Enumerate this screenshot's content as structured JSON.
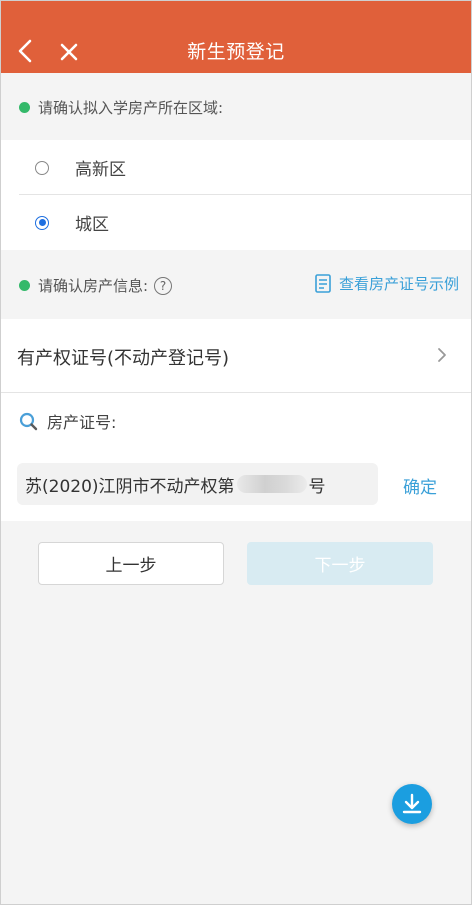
{
  "header": {
    "title": "新生预登记"
  },
  "area_section": {
    "prompt": "请确认拟入学房产所在区域:",
    "options": [
      {
        "label": "高新区",
        "selected": false
      },
      {
        "label": "城区",
        "selected": true
      }
    ]
  },
  "property_section": {
    "prompt": "请确认房产信息:",
    "help_glyph": "?",
    "example_link": "查看房产证号示例"
  },
  "certificate_type": {
    "label": "有产权证号(不动产登记号)"
  },
  "certificate_search": {
    "label": "房产证号:",
    "value_prefix": "苏(2020)江阴市不动产权第",
    "value_suffix": "号",
    "confirm_label": "确定"
  },
  "navigation": {
    "prev_label": "上一步",
    "next_label": "下一步"
  },
  "colors": {
    "header": "#e0603a",
    "accent_green": "#34b96a",
    "link_blue": "#3aa0d8",
    "radio_blue": "#1e6fe0",
    "fab_blue": "#1b9ee0",
    "next_disabled": "#d8ebf2"
  },
  "icons": {
    "back": "back-arrow-icon",
    "close": "close-icon",
    "help": "question-circle-icon",
    "example": "document-icon",
    "chevron": "chevron-right-icon",
    "search": "search-icon",
    "download": "download-icon"
  }
}
